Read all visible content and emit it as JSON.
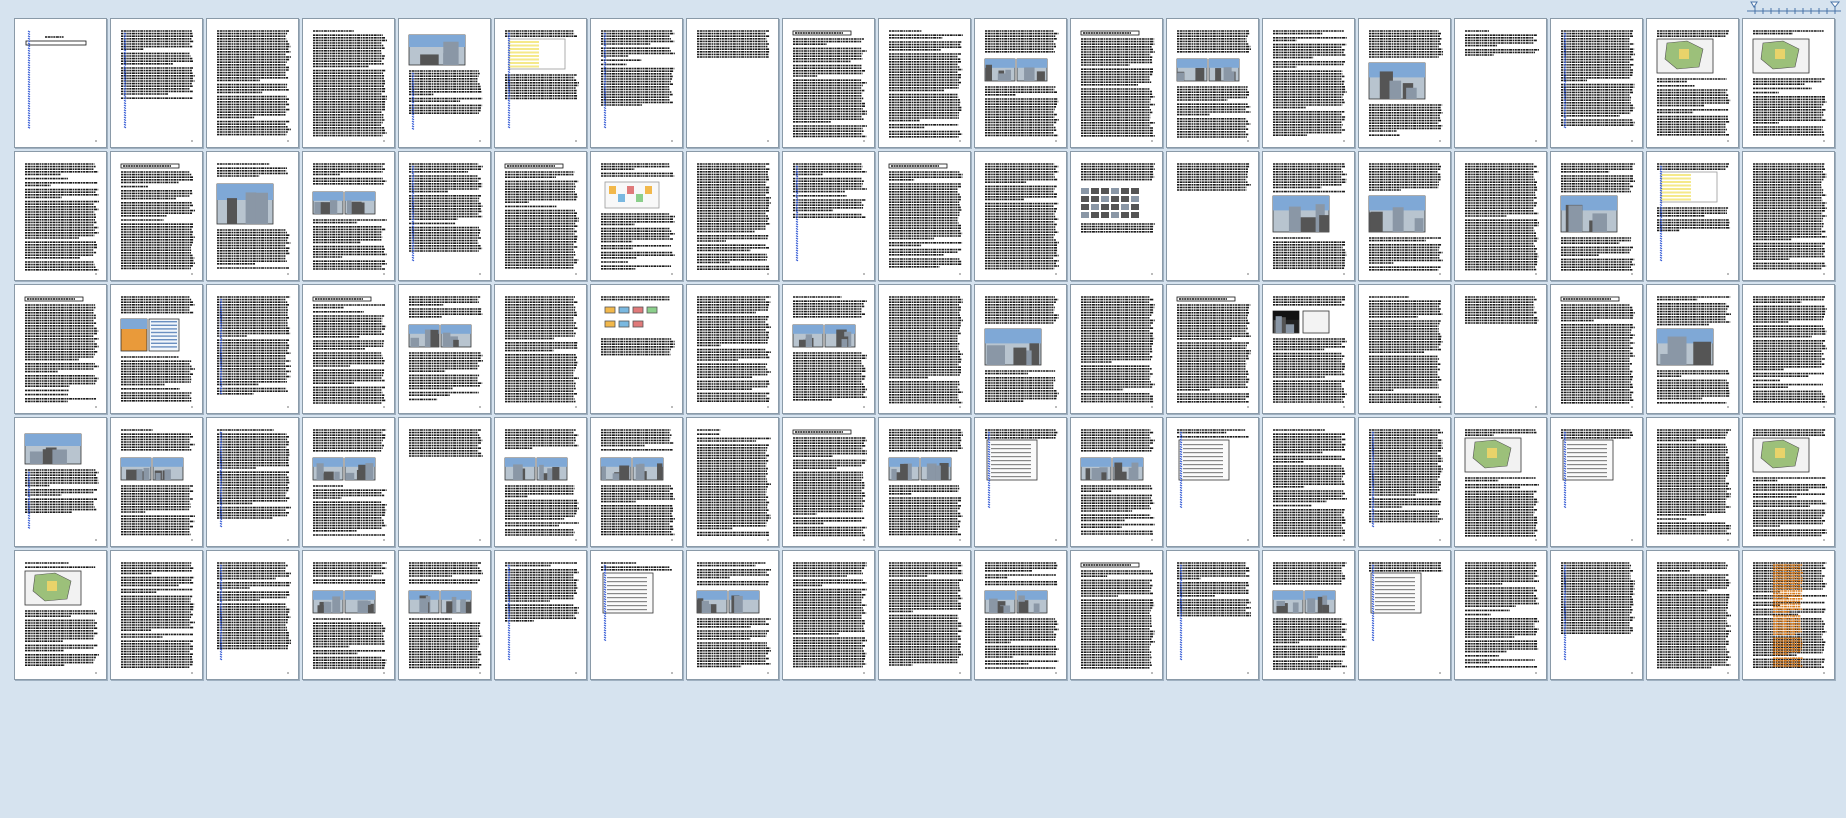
{
  "window": {
    "background": "#d6e3ef",
    "page_background": "#ffffff",
    "page_border": "#8a9aa8"
  },
  "thumbnails": {
    "rows": 5,
    "columns": 19,
    "page_count": 95,
    "pages": [
      {
        "n": 1,
        "v": "title"
      },
      {
        "n": 2,
        "v": "text-link"
      },
      {
        "n": 3,
        "v": "text"
      },
      {
        "n": 4,
        "v": "text"
      },
      {
        "n": 5,
        "v": "photo-top"
      },
      {
        "n": 6,
        "v": "table-yellow"
      },
      {
        "n": 7,
        "v": "text-link"
      },
      {
        "n": 8,
        "v": "text-short"
      },
      {
        "n": 9,
        "v": "heading"
      },
      {
        "n": 10,
        "v": "text"
      },
      {
        "n": 11,
        "v": "photos-grid"
      },
      {
        "n": 12,
        "v": "heading"
      },
      {
        "n": 13,
        "v": "photos-grid"
      },
      {
        "n": 14,
        "v": "text"
      },
      {
        "n": 15,
        "v": "photo-mid"
      },
      {
        "n": 16,
        "v": "text-short"
      },
      {
        "n": 17,
        "v": "text-link"
      },
      {
        "n": 18,
        "v": "map"
      },
      {
        "n": 19,
        "v": "map"
      },
      {
        "n": 20,
        "v": "text"
      },
      {
        "n": 21,
        "v": "heading"
      },
      {
        "n": 22,
        "v": "photo-large"
      },
      {
        "n": 23,
        "v": "photos-grid"
      },
      {
        "n": 24,
        "v": "text-link"
      },
      {
        "n": 25,
        "v": "heading"
      },
      {
        "n": 26,
        "v": "diagram"
      },
      {
        "n": 27,
        "v": "text"
      },
      {
        "n": 28,
        "v": "text-link"
      },
      {
        "n": 29,
        "v": "heading"
      },
      {
        "n": 30,
        "v": "text"
      },
      {
        "n": 31,
        "v": "collage"
      },
      {
        "n": 32,
        "v": "text-short"
      },
      {
        "n": 33,
        "v": "photo-mid"
      },
      {
        "n": 34,
        "v": "photo-mid"
      },
      {
        "n": 35,
        "v": "text"
      },
      {
        "n": 36,
        "v": "photo-mid"
      },
      {
        "n": 37,
        "v": "table-yellow"
      },
      {
        "n": 38,
        "v": "text"
      },
      {
        "n": 39,
        "v": "heading"
      },
      {
        "n": 40,
        "v": "chart-orange"
      },
      {
        "n": 41,
        "v": "text-link"
      },
      {
        "n": 42,
        "v": "heading"
      },
      {
        "n": 43,
        "v": "photos-grid"
      },
      {
        "n": 44,
        "v": "text"
      },
      {
        "n": 45,
        "v": "flowchart"
      },
      {
        "n": 46,
        "v": "text"
      },
      {
        "n": 47,
        "v": "photos-grid"
      },
      {
        "n": 48,
        "v": "text"
      },
      {
        "n": 49,
        "v": "photo-mid"
      },
      {
        "n": 50,
        "v": "text"
      },
      {
        "n": 51,
        "v": "heading"
      },
      {
        "n": 52,
        "v": "photo-dark"
      },
      {
        "n": 53,
        "v": "text"
      },
      {
        "n": 54,
        "v": "text-short"
      },
      {
        "n": 55,
        "v": "heading"
      },
      {
        "n": 56,
        "v": "photo-mid"
      },
      {
        "n": 57,
        "v": "text"
      },
      {
        "n": 58,
        "v": "photo-top"
      },
      {
        "n": 59,
        "v": "photos-grid"
      },
      {
        "n": 60,
        "v": "text-link"
      },
      {
        "n": 61,
        "v": "photos-grid"
      },
      {
        "n": 62,
        "v": "text-short"
      },
      {
        "n": 63,
        "v": "photos-grid"
      },
      {
        "n": 64,
        "v": "photos-grid"
      },
      {
        "n": 65,
        "v": "text"
      },
      {
        "n": 66,
        "v": "heading"
      },
      {
        "n": 67,
        "v": "photos-grid"
      },
      {
        "n": 68,
        "v": "document"
      },
      {
        "n": 69,
        "v": "photos-grid"
      },
      {
        "n": 70,
        "v": "document"
      },
      {
        "n": 71,
        "v": "text"
      },
      {
        "n": 72,
        "v": "text-link"
      },
      {
        "n": 73,
        "v": "map"
      },
      {
        "n": 74,
        "v": "document"
      },
      {
        "n": 75,
        "v": "text"
      },
      {
        "n": 76,
        "v": "map"
      },
      {
        "n": 77,
        "v": "map"
      },
      {
        "n": 78,
        "v": "text"
      },
      {
        "n": 79,
        "v": "text-link"
      },
      {
        "n": 80,
        "v": "photos-grid"
      },
      {
        "n": 81,
        "v": "photos-grid"
      },
      {
        "n": 82,
        "v": "text-link"
      },
      {
        "n": 83,
        "v": "document"
      },
      {
        "n": 84,
        "v": "photos-grid"
      },
      {
        "n": 85,
        "v": "text"
      },
      {
        "n": 86,
        "v": "text"
      },
      {
        "n": 87,
        "v": "photos-grid"
      },
      {
        "n": 88,
        "v": "heading"
      },
      {
        "n": 89,
        "v": "text-link"
      },
      {
        "n": 90,
        "v": "photos-grid"
      },
      {
        "n": 91,
        "v": "document"
      },
      {
        "n": 92,
        "v": "text"
      },
      {
        "n": 93,
        "v": "text-link"
      },
      {
        "n": 94,
        "v": "text"
      },
      {
        "n": 95,
        "v": "text-orange"
      }
    ]
  },
  "colors": {
    "text_mark": "#1a1a1a",
    "link_mark": "#3a5fd6",
    "photo_dark": "#555555",
    "photo_mid": "#8a97a6",
    "photo_light": "#b8c4cf",
    "photo_sky": "#7fa8d6",
    "map_green": "#9cc07a",
    "map_yellow": "#e8d36a",
    "chart_orange": "#e99a3a",
    "table_yellow": "#f5e98a",
    "orange_text": "#d97a1a",
    "flow_colors": [
      "#f2b84b",
      "#7ab8e0",
      "#e07a7a",
      "#8bcf8b"
    ]
  },
  "icons": {
    "ruler": "ruler-icon"
  }
}
